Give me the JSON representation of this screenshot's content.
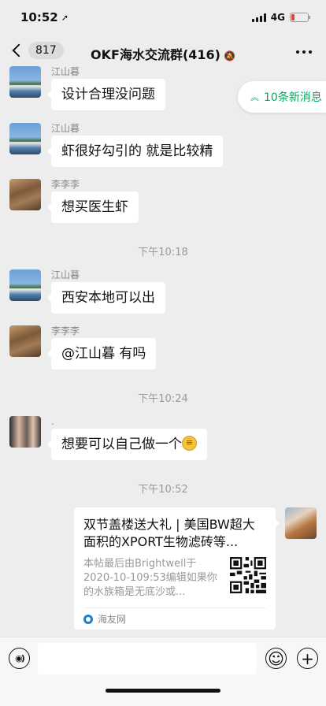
{
  "status_bar": {
    "time": "10:52",
    "location_icon": "➚",
    "network": "4G"
  },
  "nav": {
    "back_count": "817",
    "title": "OKF海水交流群(416)",
    "mute_icon": "🔕"
  },
  "new_messages": {
    "label": "10条新消息",
    "icon": "︽"
  },
  "messages": [
    {
      "sender": "江山暮",
      "text": "设计合理没问题"
    },
    {
      "sender": "江山暮",
      "text": "虾很好勾引的 就是比较精"
    },
    {
      "sender": "李李李",
      "text": "想买医生虾"
    },
    {
      "sender": "江山暮",
      "text": "西安本地可以出"
    },
    {
      "sender": "李李李",
      "text": "@江山暮 有吗"
    },
    {
      "sender": ".",
      "text": "想要可以自己做一个",
      "emoji": "😁"
    }
  ],
  "timestamps": [
    "下午10:18",
    "下午10:24",
    "下午10:52"
  ],
  "link_card": {
    "title": "双节盖楼送大礼 | 美国BW超大面积的XPORT生物滤砖等...",
    "description": "本帖最后由Brightwell于2020-10-109:53编辑如果你的水族箱是无底沙或...",
    "source": "海友网"
  },
  "input_bar": {
    "voice_icon": "◉)",
    "emoji_icon": "☺",
    "plus_icon": "+",
    "placeholder": ""
  },
  "colors": {
    "accent": "#07a85c",
    "background": "#ededed",
    "bubble": "#ffffff"
  }
}
